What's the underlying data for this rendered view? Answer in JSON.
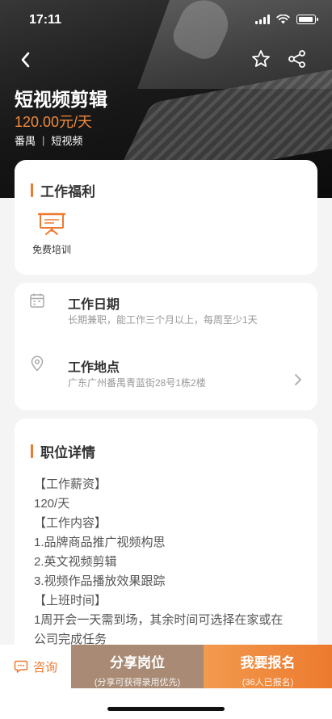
{
  "status_bar": {
    "time": "17:11"
  },
  "header": {
    "title": "短视频剪辑",
    "salary": "120.00元/天",
    "location": "番禺",
    "separator": "|",
    "category": "短视频"
  },
  "benefits": {
    "title": "工作福利",
    "items": [
      {
        "label": "免费培训",
        "icon": "training-board-icon"
      }
    ]
  },
  "info": {
    "date": {
      "title": "工作日期",
      "value": "长期兼职，能工作三个月以上，每周至少1天"
    },
    "address": {
      "title": "工作地点",
      "value": "广东广州番禺青蓝街28号1栋2楼"
    }
  },
  "detail": {
    "title": "职位详情",
    "lines": [
      "【工作薪资】",
      "120/天",
      "【工作内容】",
      "1.品牌商品推广视频构思",
      "2.英文视频剪辑",
      "3.视频作品播放效果跟踪",
      "【上班时间】",
      "1周开会一天需到场，其余时间可选择在家或在",
      "公司完成任务"
    ]
  },
  "actions": {
    "consult": "咨询",
    "share": {
      "label": "分享岗位",
      "sub": "(分享可获得录用优先)"
    },
    "apply": {
      "label": "我要报名",
      "sub": "(36人已报名)"
    }
  },
  "colors": {
    "accent": "#ee7a30",
    "share_bg": "#a98b75"
  }
}
